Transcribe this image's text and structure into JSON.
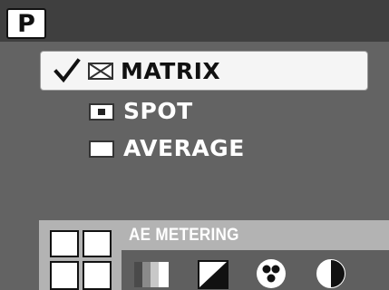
{
  "mode_badge": "P",
  "menu": {
    "items": [
      {
        "label": "MATRIX",
        "icon": "matrix-metering-icon",
        "selected": true,
        "check": "check-icon"
      },
      {
        "label": "SPOT",
        "icon": "spot-metering-icon",
        "selected": false
      },
      {
        "label": "AVERAGE",
        "icon": "average-metering-icon",
        "selected": false
      }
    ]
  },
  "info": {
    "title": "AE METERING"
  },
  "bottom_icons": [
    "ae-metering-icon",
    "white-balance-icon",
    "exposure-compensation-icon",
    "color-mode-icon",
    "contrast-icon"
  ],
  "colors": {
    "background": "#636363",
    "topbar": "#3f3f3f",
    "selected_row": "#f5f5f5",
    "info_strip": "#b3b3b3",
    "text_light": "#ffffff",
    "text_dark": "#111111"
  }
}
